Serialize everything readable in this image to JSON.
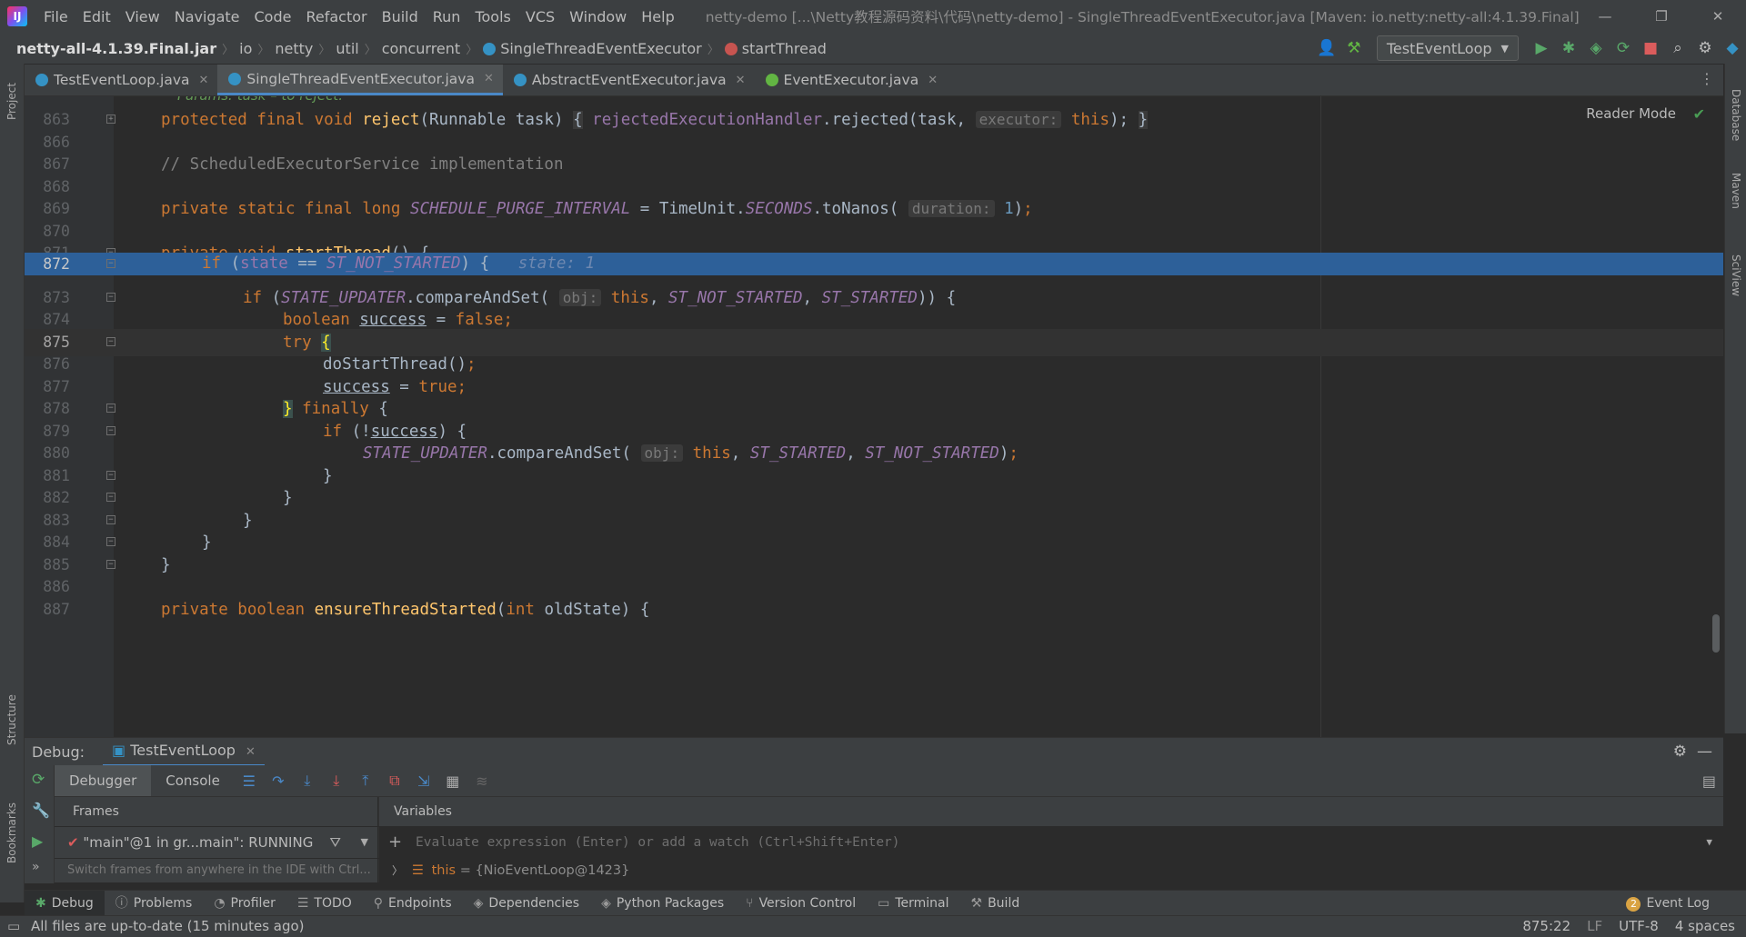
{
  "title_bar": {
    "menu": [
      "File",
      "Edit",
      "View",
      "Navigate",
      "Code",
      "Refactor",
      "Build",
      "Run",
      "Tools",
      "VCS",
      "Window",
      "Help"
    ],
    "window_title": "netty-demo [...\\Netty教程源码资料\\代码\\netty-demo] - SingleThreadEventExecutor.java [Maven: io.netty:netty-all:4.1.39.Final]"
  },
  "breadcrumb": [
    "netty-all-4.1.39.Final.jar",
    "io",
    "netty",
    "util",
    "concurrent",
    "SingleThreadEventExecutor",
    "startThread"
  ],
  "run_config": "TestEventLoop",
  "tabs": [
    {
      "label": "TestEventLoop.java",
      "color": "#3592c4"
    },
    {
      "label": "SingleThreadEventExecutor.java",
      "color": "#3592c4"
    },
    {
      "label": "AbstractEventExecutor.java",
      "color": "#3592c4"
    },
    {
      "label": "EventExecutor.java",
      "color": "#62b543"
    }
  ],
  "active_tab": "SingleThreadEventExecutor.java",
  "left_strip": {
    "project": "Project",
    "structure": "Structure",
    "bookmarks": "Bookmarks"
  },
  "right_strip": {
    "database": "Database",
    "maven": "Maven",
    "sciview": "SciView"
  },
  "editor": {
    "reader_mode": "Reader Mode",
    "doc_fragment": "Params: task – to reject.",
    "line_numbers": [
      "863",
      "866",
      "867",
      "868",
      "869",
      "870",
      "871",
      "872",
      "873",
      "874",
      "875",
      "876",
      "877",
      "878",
      "879",
      "880",
      "881",
      "882",
      "883",
      "884",
      "885",
      "886",
      "887"
    ],
    "current_line": "875",
    "breakpoint_line": "872",
    "hints": {
      "executor": "executor:",
      "duration": "duration:",
      "obj": "obj:"
    },
    "inline_value": "state: 1"
  },
  "debug": {
    "label": "Debug:",
    "session": "TestEventLoop",
    "tabs": [
      "Debugger",
      "Console"
    ],
    "frames_header": "Frames",
    "variables_header": "Variables",
    "thread": "\"main\"@1 in gr...main\": RUNNING",
    "frames_hint": "Switch frames from anywhere in the IDE with Ctrl...",
    "eval_placeholder": "Evaluate expression (Enter) or add a watch (Ctrl+Shift+Enter)",
    "var_name": "this",
    "var_value": "= {NioEventLoop@1423}"
  },
  "bottom_tabs": [
    "Debug",
    "Problems",
    "Profiler",
    "TODO",
    "Endpoints",
    "Dependencies",
    "Python Packages",
    "Version Control",
    "Terminal",
    "Build"
  ],
  "event_log": {
    "count": "2",
    "label": "Event Log"
  },
  "status": {
    "message": "All files are up-to-date (15 minutes ago)",
    "position": "875:22",
    "line_sep": "LF",
    "encoding": "UTF-8",
    "indent": "4 spaces"
  }
}
